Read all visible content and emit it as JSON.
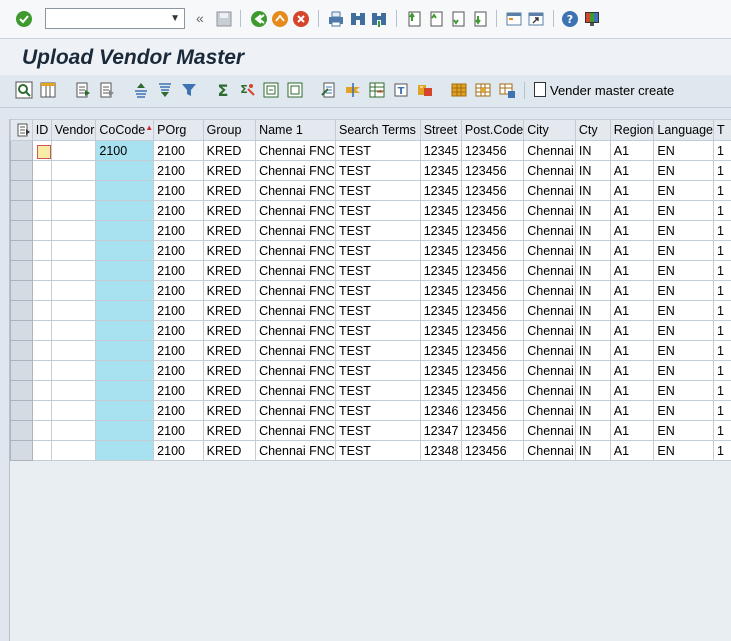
{
  "window": {
    "command_field_value": "",
    "title": "Upload Vendor Master"
  },
  "toolbar": {
    "create_label": "Vender master create"
  },
  "grid": {
    "columns": [
      "ID",
      "Vendor",
      "CoCode",
      "POrg",
      "Group",
      "Name 1",
      "Search Terms",
      "Street",
      "Post.Code",
      "City",
      "Cty",
      "Region",
      "Language",
      "T"
    ],
    "rows": [
      [
        "",
        "",
        "2100",
        "2100",
        "KRED",
        "Chennai FNC",
        "TEST",
        "12345",
        "123456",
        "Chennai",
        "IN",
        "A1",
        "EN",
        "1"
      ],
      [
        "",
        "",
        "",
        "2100",
        "KRED",
        "Chennai FNC",
        "TEST",
        "12345",
        "123456",
        "Chennai",
        "IN",
        "A1",
        "EN",
        "1"
      ],
      [
        "",
        "",
        "",
        "2100",
        "KRED",
        "Chennai FNC",
        "TEST",
        "12345",
        "123456",
        "Chennai",
        "IN",
        "A1",
        "EN",
        "1"
      ],
      [
        "",
        "",
        "",
        "2100",
        "KRED",
        "Chennai FNC",
        "TEST",
        "12345",
        "123456",
        "Chennai",
        "IN",
        "A1",
        "EN",
        "1"
      ],
      [
        "",
        "",
        "",
        "2100",
        "KRED",
        "Chennai FNC",
        "TEST",
        "12345",
        "123456",
        "Chennai",
        "IN",
        "A1",
        "EN",
        "1"
      ],
      [
        "",
        "",
        "",
        "2100",
        "KRED",
        "Chennai FNC",
        "TEST",
        "12345",
        "123456",
        "Chennai",
        "IN",
        "A1",
        "EN",
        "1"
      ],
      [
        "",
        "",
        "",
        "2100",
        "KRED",
        "Chennai FNC",
        "TEST",
        "12345",
        "123456",
        "Chennai",
        "IN",
        "A1",
        "EN",
        "1"
      ],
      [
        "",
        "",
        "",
        "2100",
        "KRED",
        "Chennai FNC",
        "TEST",
        "12345",
        "123456",
        "Chennai",
        "IN",
        "A1",
        "EN",
        "1"
      ],
      [
        "",
        "",
        "",
        "2100",
        "KRED",
        "Chennai FNC",
        "TEST",
        "12345",
        "123456",
        "Chennai",
        "IN",
        "A1",
        "EN",
        "1"
      ],
      [
        "",
        "",
        "",
        "2100",
        "KRED",
        "Chennai FNC",
        "TEST",
        "12345",
        "123456",
        "Chennai",
        "IN",
        "A1",
        "EN",
        "1"
      ],
      [
        "",
        "",
        "",
        "2100",
        "KRED",
        "Chennai FNC",
        "TEST",
        "12345",
        "123456",
        "Chennai",
        "IN",
        "A1",
        "EN",
        "1"
      ],
      [
        "",
        "",
        "",
        "2100",
        "KRED",
        "Chennai FNC",
        "TEST",
        "12345",
        "123456",
        "Chennai",
        "IN",
        "A1",
        "EN",
        "1"
      ],
      [
        "",
        "",
        "",
        "2100",
        "KRED",
        "Chennai FNC",
        "TEST",
        "12345",
        "123456",
        "Chennai",
        "IN",
        "A1",
        "EN",
        "1"
      ],
      [
        "",
        "",
        "",
        "2100",
        "KRED",
        "Chennai FNC",
        "TEST",
        "12346",
        "123456",
        "Chennai",
        "IN",
        "A1",
        "EN",
        "1"
      ],
      [
        "",
        "",
        "",
        "2100",
        "KRED",
        "Chennai FNC",
        "TEST",
        "12347",
        "123456",
        "Chennai",
        "IN",
        "A1",
        "EN",
        "1"
      ],
      [
        "",
        "",
        "",
        "2100",
        "KRED",
        "Chennai FNC",
        "TEST",
        "12348",
        "123456",
        "Chennai",
        "IN",
        "A1",
        "EN",
        "1"
      ]
    ]
  }
}
